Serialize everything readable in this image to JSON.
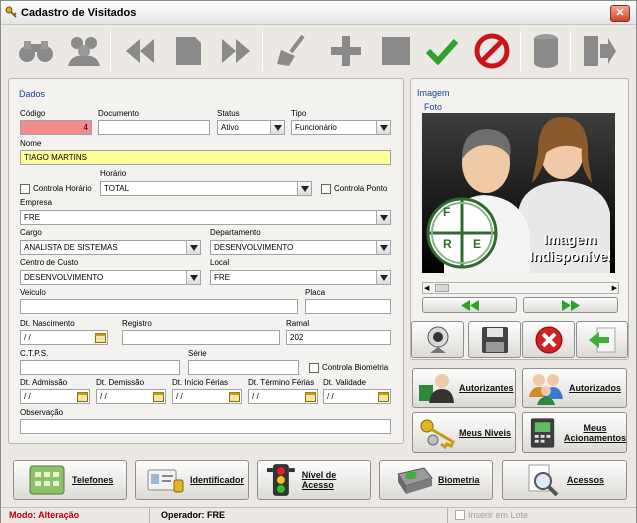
{
  "window": {
    "title": "Cadastro de Visitados",
    "close_label": "✕"
  },
  "toolbar": {
    "buttons": [
      "binoculars-icon",
      "group-search-icon",
      "prev-icon",
      "record-icon",
      "next-icon",
      "clear-icon",
      "add-icon",
      "stop-icon",
      "confirm-icon",
      "cancel-icon",
      "database-icon",
      "exit-icon"
    ]
  },
  "dados": {
    "group_label": "Dados",
    "codigo": {
      "label": "Código",
      "value": "4"
    },
    "documento": {
      "label": "Documento",
      "value": ""
    },
    "status": {
      "label": "Status",
      "value": "Ativo"
    },
    "tipo": {
      "label": "Tipo",
      "value": "Funcionário"
    },
    "nome": {
      "label": "Nome",
      "value": "TIAGO MARTINS"
    },
    "controla_horario": {
      "label": "Controla Horário"
    },
    "horario": {
      "label": "Horário",
      "value": "TOTAL"
    },
    "controla_ponto": {
      "label": "Controla Ponto"
    },
    "empresa": {
      "label": "Empresa",
      "value": "FRE"
    },
    "cargo": {
      "label": "Cargo",
      "value": "ANALISTA DE SISTEMAS"
    },
    "departamento": {
      "label": "Departamento",
      "value": "DESENVOLVIMENTO"
    },
    "centro_custo": {
      "label": "Centro de Custo",
      "value": "DESENVOLVIMENTO"
    },
    "local": {
      "label": "Local",
      "value": "FRE"
    },
    "veiculo": {
      "label": "Veiculo",
      "value": ""
    },
    "placa": {
      "label": "Placa",
      "value": ""
    },
    "dt_nascimento": {
      "label": "Dt. Nascimento",
      "value": " / /"
    },
    "registro": {
      "label": "Registro",
      "value": ""
    },
    "ramal": {
      "label": "Ramal",
      "value": "202"
    },
    "ctps": {
      "label": "C.T.P.S.",
      "value": ""
    },
    "serie": {
      "label": "Série",
      "value": ""
    },
    "controla_biometria": {
      "label": "Controla Biometria"
    },
    "dt_admissao": {
      "label": "Dt. Admissão",
      "value": " / /"
    },
    "dt_demissao": {
      "label": "Dt. Demissão",
      "value": " / /"
    },
    "dt_inicio_ferias": {
      "label": "Dt. Início Férias",
      "value": " / /"
    },
    "dt_termino_ferias": {
      "label": "Dt. Término Férias",
      "value": " / /"
    },
    "dt_validade": {
      "label": "Dt. Validade",
      "value": " / /"
    },
    "observacao": {
      "label": "Observação",
      "value": ""
    }
  },
  "imagem": {
    "group_label": "Imagem",
    "foto_label": "Foto",
    "placeholder_line1": "Imagem",
    "placeholder_line2": "Indisponível",
    "logo_letters": [
      "F",
      "R",
      "E"
    ]
  },
  "side_buttons": {
    "autorizantes": "Autorizantes",
    "autorizados": "Autorizados",
    "meus_niveis": "Meus Niveis",
    "meus_acionamentos_1": "Meus",
    "meus_acionamentos_2": "Acionamentos"
  },
  "bottom_buttons": {
    "telefones": "Telefones",
    "identificador": "Identificador",
    "nivel_acesso": "Nível de Acesso",
    "biometria": "Biometria",
    "acessos": "Acessos"
  },
  "statusbar": {
    "modo": "Modo: Alteração",
    "operador": "Operador: FRE",
    "inserir_lote": "Inserir em Lote"
  },
  "colors": {
    "codigo_bg": "#f28b8b",
    "nome_bg": "#ffff99",
    "modo_text": "#c00000",
    "group_label": "#1a3f9f"
  }
}
